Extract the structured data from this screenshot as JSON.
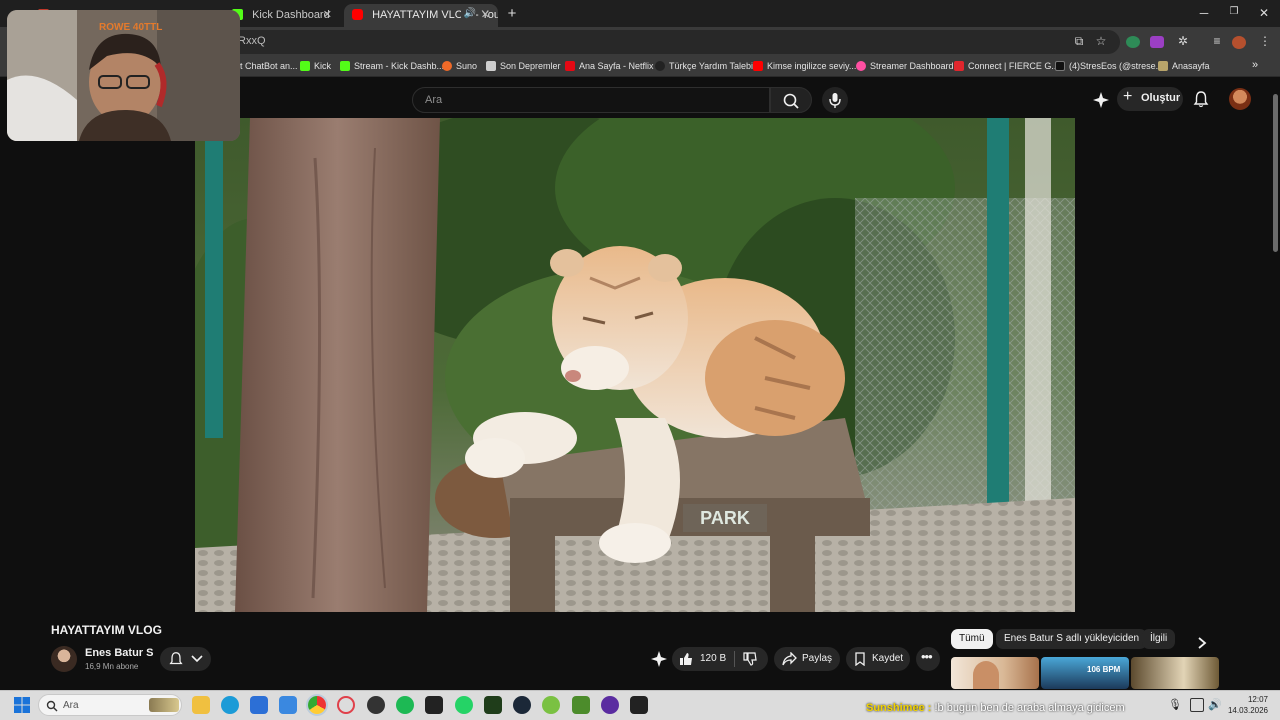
{
  "browser": {
    "tabs": [
      {
        "label": "",
        "active": false
      },
      {
        "label": "Kick Dashboard",
        "active": false
      },
      {
        "label": "HAYATTAYIM VLOG - YouTu",
        "active": true
      }
    ],
    "url": "RxxQ",
    "bookmarks": [
      {
        "label": "t ChatBot an...",
        "color": "#4b4b4b"
      },
      {
        "label": "Kick",
        "color": "#53fc18"
      },
      {
        "label": "Stream - Kick Dashb...",
        "color": "#53fc18"
      },
      {
        "label": "Suno",
        "color": "#f06a28"
      },
      {
        "label": "Son Depremler",
        "color": "#cfcfcf"
      },
      {
        "label": "Ana Sayfa - Netflix",
        "color": "#e50914"
      },
      {
        "label": "Türkçe Yardım Talebi",
        "color": "#222222"
      },
      {
        "label": "Kimse ingilizce seviy...",
        "color": "#ff0000"
      },
      {
        "label": "Streamer Dashboard",
        "color": "#ff4fa2"
      },
      {
        "label": "Connect | FIERCE G...",
        "color": "#e0262d"
      },
      {
        "label": "(4)StresEos (@strese...",
        "color": "#111111"
      },
      {
        "label": "Anasayfa",
        "color": "#b8a46a"
      }
    ]
  },
  "webcam": {
    "overlay_text": "ROWE 40TTL"
  },
  "youtube": {
    "search_placeholder": "Ara",
    "create_label": "Oluştur",
    "video_sign": "PARK",
    "video_title": "HAYATTAYIM VLOG",
    "channel_name": "Enes Batur S",
    "subscribers": "16,9 Mn abone",
    "likes": "120 B",
    "share_label": "Paylaş",
    "save_label": "Kaydet",
    "chips": [
      "Tümü",
      "Enes Batur S adlı yükleyiciden",
      "İlgili"
    ],
    "thumb_badge": "106 BPM"
  },
  "taskbar": {
    "search_placeholder": "Ara",
    "ticker_name": "Sunshimee :",
    "ticker_message": "!b bugün ben de araba almaya gidicem",
    "time": "12:07",
    "date": "14.03.2026"
  },
  "colors": {
    "youtube_red": "#ff0000",
    "accent_chip": "#f1f1f1"
  }
}
